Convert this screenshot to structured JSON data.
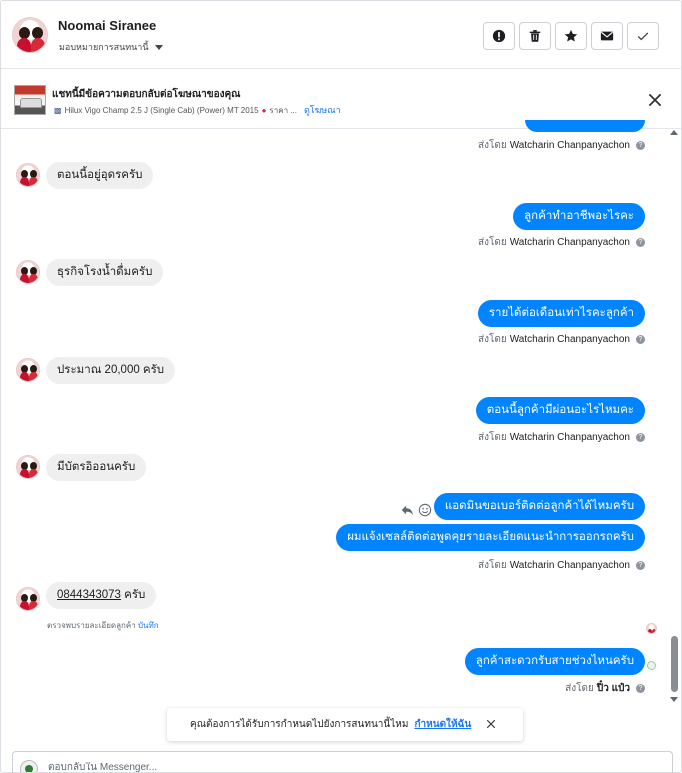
{
  "header": {
    "name": "Noomai Siranee",
    "owner_label": "มอบหมายการสนทนานี้",
    "actions": [
      "important-icon",
      "trash-icon",
      "star-icon",
      "mail-icon",
      "check-icon"
    ]
  },
  "ad": {
    "title": "แชทนี้มีข้อความตอบกลับต่อโฆษณาของคุณ",
    "subtitle": "Hilux Vigo Champ 2.5 J (Single Cab) (Power) MT 2015",
    "price_fragment": "ราคา ...",
    "view_ad": "ดูโฆษณา"
  },
  "messages": [
    {
      "dir": "meta",
      "sender_prefix": "ส่งโดย",
      "sender": "Watcharin Chanpanyachon"
    },
    {
      "dir": "in",
      "text": "ตอนนี้อยู่อุดรครับ"
    },
    {
      "dir": "out",
      "text": "ลูกค้าทำอาชีพอะไรคะ"
    },
    {
      "dir": "meta",
      "sender_prefix": "ส่งโดย",
      "sender": "Watcharin Chanpanyachon"
    },
    {
      "dir": "in",
      "text": "ธุรกิจโรงน้ำดื่มครับ"
    },
    {
      "dir": "out",
      "text": "รายได้ต่อเดือนเท่าไรคะลูกค้า"
    },
    {
      "dir": "meta",
      "sender_prefix": "ส่งโดย",
      "sender": "Watcharin Chanpanyachon"
    },
    {
      "dir": "in",
      "text": "ประมาณ 20,000 ครับ"
    },
    {
      "dir": "out",
      "text": "ตอนนี้ลูกค้ามีผ่อนอะไรไหมคะ"
    },
    {
      "dir": "meta",
      "sender_prefix": "ส่งโดย",
      "sender": "Watcharin Chanpanyachon"
    },
    {
      "dir": "in",
      "text": "มีบัตรอิออนครับ"
    },
    {
      "dir": "out",
      "text": "แอดมินขอเบอร์ติดต่อลูกค้าได้ไหมครับ"
    },
    {
      "dir": "out",
      "text": "ผมแจ้งเซลล์ติดต่อพูดคุยรายละเอียดแนะนำการออกรถครับ"
    },
    {
      "dir": "meta",
      "sender_prefix": "ส่งโดย",
      "sender": "Watcharin Chanpanyachon"
    },
    {
      "dir": "in",
      "phone": "0844343073",
      "suffix": " ครับ"
    },
    {
      "dir": "out",
      "text": "ลูกค้าสะดวกรับสายช่วงไหนครับ"
    },
    {
      "dir": "meta",
      "sender_prefix": "ส่งโดย",
      "sender": "ปิ๋ว แป๋ว"
    }
  ],
  "phone_note": {
    "text": "ตรวจพบรายละเอียดลูกค้า",
    "link": "บันทึก"
  },
  "toast": {
    "text": "คุณต้องการได้รับการกำหนดไปยังการสนทนานี้ไหม",
    "link": "กำหนดให้ฉัน"
  },
  "composer": {
    "placeholder": "ตอบกลับใน Messenger..."
  },
  "colors": {
    "outgoing": "#0084ff",
    "incoming": "#efefef",
    "link": "#1877f2"
  }
}
